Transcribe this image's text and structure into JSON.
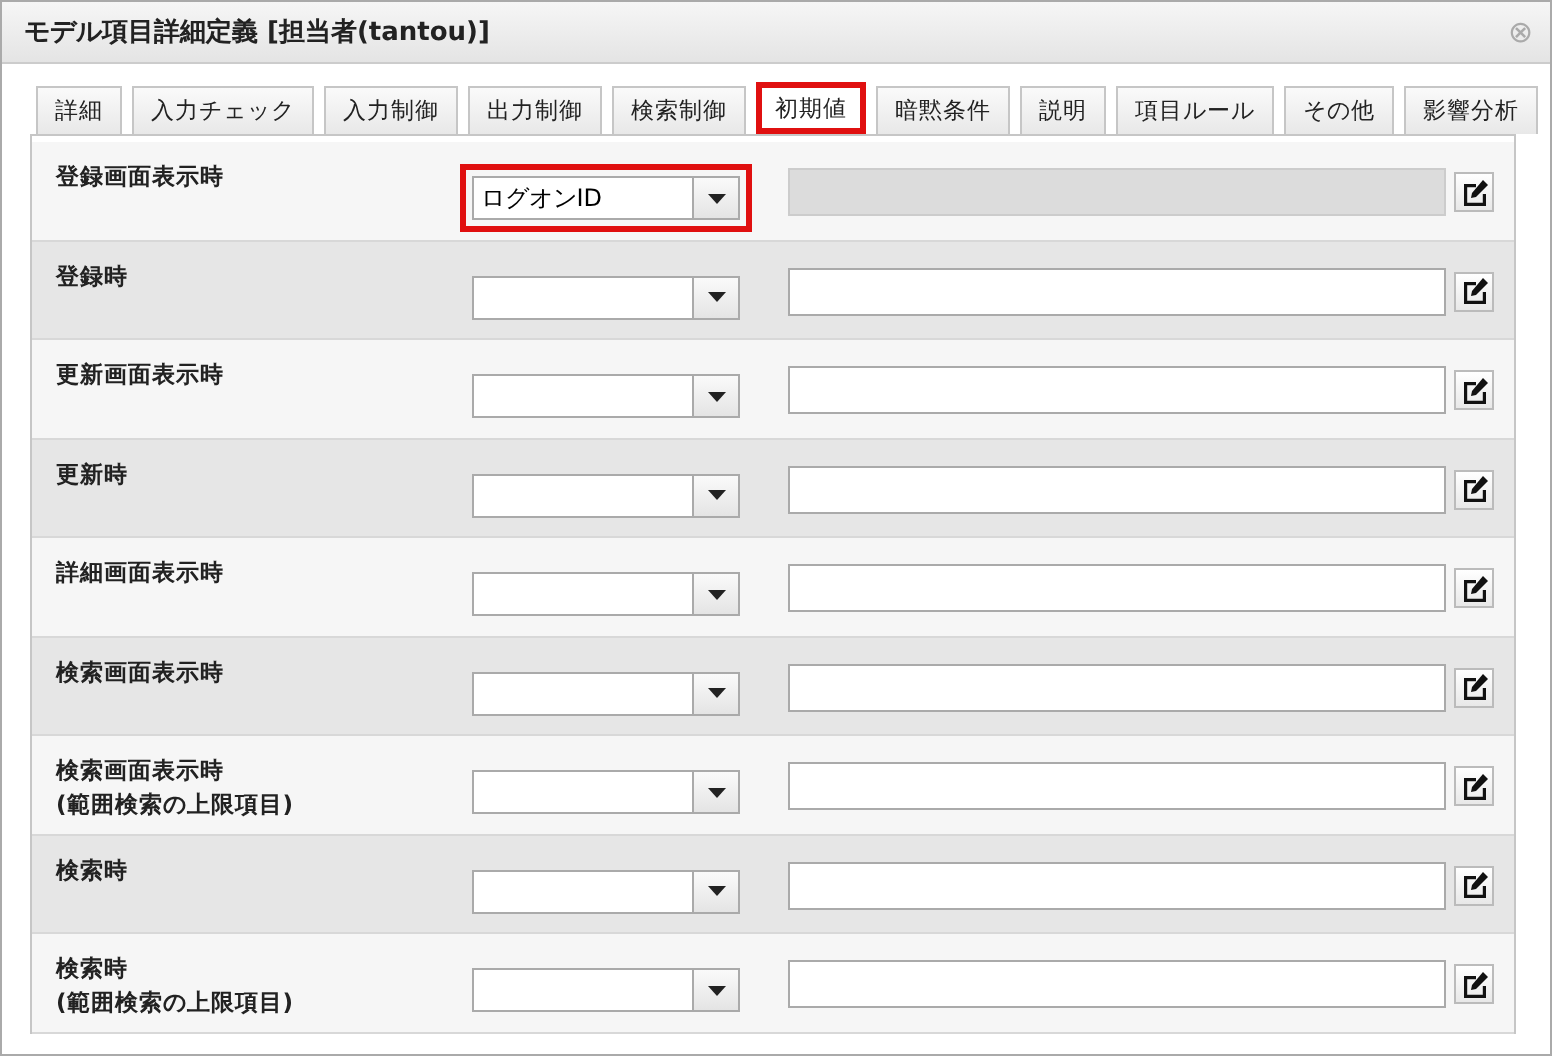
{
  "window": {
    "title": "モデル項目詳細定義 [担当者(tantou)]",
    "close": "⊗"
  },
  "tabs": [
    {
      "label": "詳細",
      "selected": false,
      "highlighted": false
    },
    {
      "label": "入力チェック",
      "selected": false,
      "highlighted": false
    },
    {
      "label": "入力制御",
      "selected": false,
      "highlighted": false
    },
    {
      "label": "出力制御",
      "selected": false,
      "highlighted": false
    },
    {
      "label": "検索制御",
      "selected": false,
      "highlighted": false
    },
    {
      "label": "初期値",
      "selected": true,
      "highlighted": true
    },
    {
      "label": "暗黙条件",
      "selected": false,
      "highlighted": false
    },
    {
      "label": "説明",
      "selected": false,
      "highlighted": false
    },
    {
      "label": "項目ルール",
      "selected": false,
      "highlighted": false
    },
    {
      "label": "その他",
      "selected": false,
      "highlighted": false
    },
    {
      "label": "影響分析",
      "selected": false,
      "highlighted": false
    }
  ],
  "rows": [
    {
      "label": [
        "登録画面表示時"
      ],
      "select": "ログオンID",
      "select_highlighted": true,
      "field_disabled": true
    },
    {
      "label": [
        "登録時"
      ],
      "select_highlighted": false,
      "field_disabled": false
    },
    {
      "label": [
        "更新画面表示時"
      ],
      "select_highlighted": false,
      "field_disabled": false
    },
    {
      "label": [
        "更新時"
      ],
      "select_highlighted": false,
      "field_disabled": false
    },
    {
      "label": [
        "詳細画面表示時"
      ],
      "select_highlighted": false,
      "field_disabled": false
    },
    {
      "label": [
        "検索画面表示時"
      ],
      "select_highlighted": false,
      "field_disabled": false
    },
    {
      "label": [
        "検索画面表示時",
        "(範囲検索の上限項目)"
      ],
      "select_highlighted": false,
      "field_disabled": false
    },
    {
      "label": [
        "検索時"
      ],
      "select_highlighted": false,
      "field_disabled": false
    },
    {
      "label": [
        "検索時",
        "(範囲検索の上限項目)"
      ],
      "select_highlighted": false,
      "field_disabled": false
    }
  ]
}
